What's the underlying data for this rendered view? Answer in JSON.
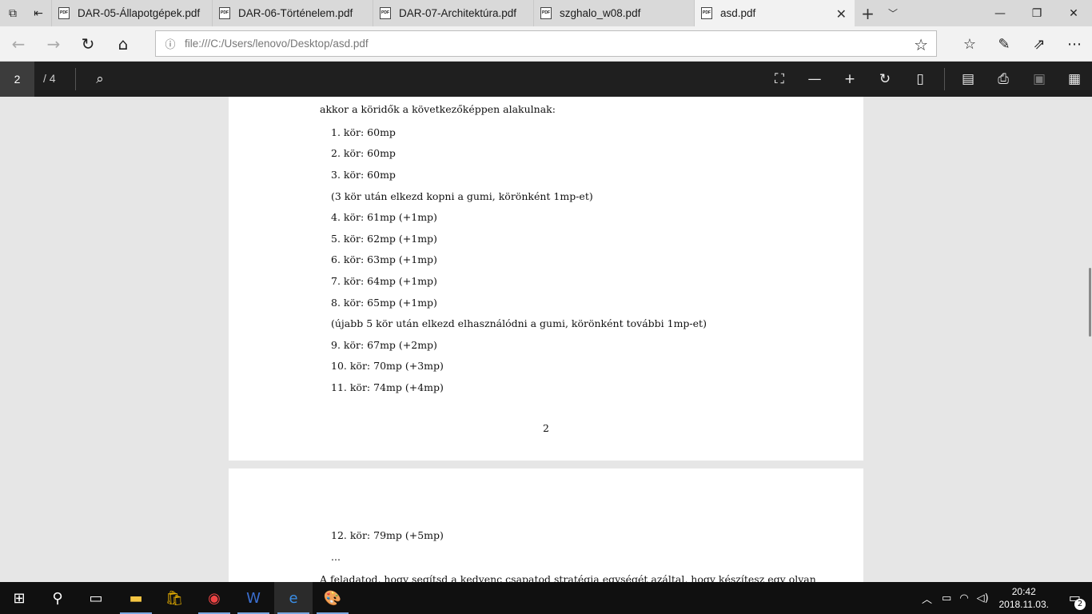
{
  "tabs": [
    {
      "label": "DAR-05-Állapotgépek.pdf"
    },
    {
      "label": "DAR-06-Történelem.pdf"
    },
    {
      "label": "DAR-07-Architektúra.pdf"
    },
    {
      "label": "szghalo_w08.pdf"
    },
    {
      "label": "asd.pdf"
    }
  ],
  "tab_icon_text": "PDF",
  "address": {
    "url": "file:///C:/Users/lenovo/Desktop/asd.pdf"
  },
  "pdf_toolbar": {
    "page": "2",
    "total": "/ 4"
  },
  "page1_lines": [
    "akkor a köridők a következőképpen alakulnak:",
    "1. kör: 60mp",
    "2. kör: 60mp",
    "3. kör: 60mp",
    "(3 kör után elkezd kopni a gumi, körönként 1mp-et)",
    "4. kör: 61mp (+1mp)",
    "5. kör: 62mp (+1mp)",
    "6. kör: 63mp (+1mp)",
    "7. kör: 64mp (+1mp)",
    "8. kör: 65mp (+1mp)",
    "(újabb 5 kör után elkezd elhasználódni a gumi, körönként további 1mp-et)",
    "9. kör: 67mp (+2mp)",
    "10. kör: 70mp (+3mp)",
    "11. kör: 74mp (+4mp)"
  ],
  "page1_number": "2",
  "page2_lines": [
    "12. kör: 79mp (+5mp)",
    "...",
    "A feladatod, hogy segítsd a kedvenc csapatod stratégia egységét azáltal, hogy készítesz egy olyan"
  ],
  "clock": {
    "time": "20:42",
    "date": "2018.11.03."
  },
  "notifications": "2"
}
